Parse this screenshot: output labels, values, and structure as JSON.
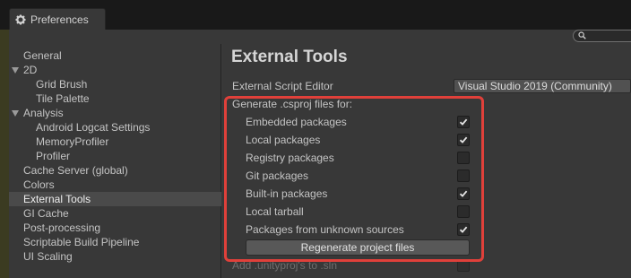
{
  "window": {
    "tab_title": "Preferences",
    "search": {
      "value": "",
      "placeholder": ""
    }
  },
  "sidebar": {
    "items": [
      {
        "label": "General"
      },
      {
        "label": "2D",
        "expanded": true
      },
      {
        "label": "Grid Brush"
      },
      {
        "label": "Tile Palette"
      },
      {
        "label": "Analysis",
        "expanded": true
      },
      {
        "label": "Android Logcat Settings"
      },
      {
        "label": "MemoryProfiler"
      },
      {
        "label": "Profiler"
      },
      {
        "label": "Cache Server (global)"
      },
      {
        "label": "Colors"
      },
      {
        "label": "External Tools",
        "selected": true
      },
      {
        "label": "GI Cache"
      },
      {
        "label": "Post-processing"
      },
      {
        "label": "Scriptable Build Pipeline"
      },
      {
        "label": "UI Scaling"
      }
    ]
  },
  "main": {
    "title": "External Tools",
    "script_editor": {
      "label": "External Script Editor",
      "value": "Visual Studio 2019 (Community)"
    },
    "csproj": {
      "header": "Generate .csproj files for:",
      "options": [
        {
          "label": "Embedded packages",
          "checked": true
        },
        {
          "label": "Local packages",
          "checked": true
        },
        {
          "label": "Registry packages",
          "checked": false
        },
        {
          "label": "Git packages",
          "checked": false
        },
        {
          "label": "Built-in packages",
          "checked": true
        },
        {
          "label": "Local tarball",
          "checked": false
        },
        {
          "label": "Packages from unknown sources",
          "checked": true
        }
      ],
      "regenerate_label": "Regenerate project files"
    },
    "unityproj": {
      "label": "Add .unityproj's to .sln",
      "checked": false,
      "disabled": true
    }
  },
  "colors": {
    "highlight_box": "#e0403a",
    "selection": "#4a4a4a",
    "background": "#383838"
  }
}
